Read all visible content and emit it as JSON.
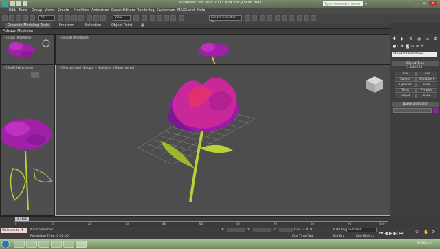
{
  "window": {
    "title": "Autodesk 3ds Max 2013 x64     flor y tallo.max",
    "search_placeholder": "Type a keyword or phrase"
  },
  "menubar": [
    "Edit",
    "Tools",
    "Group",
    "Views",
    "Create",
    "Modifiers",
    "Animation",
    "Graph Editors",
    "Rendering",
    "Customize",
    "MAXScript",
    "Help"
  ],
  "toolbar": {
    "selection_filter": "All",
    "ref_coord": "View",
    "named_selection": "Create Selection Se"
  },
  "ribbon": {
    "tabs": [
      "Graphite Modeling Tools",
      "Freeform",
      "Selection",
      "Object Paint"
    ],
    "panel_label": "Polygon Modeling"
  },
  "viewports": {
    "top": "[+] [Top] [Wireframe]",
    "front": "[+] [Front] [Wireframe]",
    "left": "[+] [Left] [Wireframe]",
    "perspective": "[+] [Perspective] [Smooth + Highlights + Edged Faces]"
  },
  "command_panel": {
    "category": "Standard Primitives",
    "object_type_header": "Object Type",
    "autogrid": "AutoGrid",
    "buttons": [
      "Box",
      "Cone",
      "Sphere",
      "GeoSphere",
      "Cylinder",
      "Tube",
      "Torus",
      "Pyramid",
      "Teapot",
      "Plane"
    ],
    "name_color_header": "Name and Color"
  },
  "timeline": {
    "frame_counter": "0 / 100",
    "ticks": [
      "0",
      "10",
      "20",
      "30",
      "40",
      "50",
      "60",
      "70",
      "80",
      "90",
      "100"
    ]
  },
  "status": {
    "maxscript": "Welcome to M",
    "selection": "None Selected",
    "render_time": "Rendering Time: 0:00:00",
    "x_label": "X:",
    "y_label": "Y:",
    "z_label": "Z:",
    "grid": "Grid = 10.0",
    "add_time_tag": "Add Time Tag",
    "auto_key": "Auto Key",
    "set_key": "Set Key",
    "key_mode": "Selected",
    "key_filters": "Key Filters...",
    "frame": "0"
  },
  "taskbar": {
    "time": "09:58 a.m."
  },
  "colors": {
    "flower": "#b020b0",
    "stem": "#b8d23a",
    "viewport_bg": "#4d4d4d",
    "active_border": "#c8b24a"
  }
}
